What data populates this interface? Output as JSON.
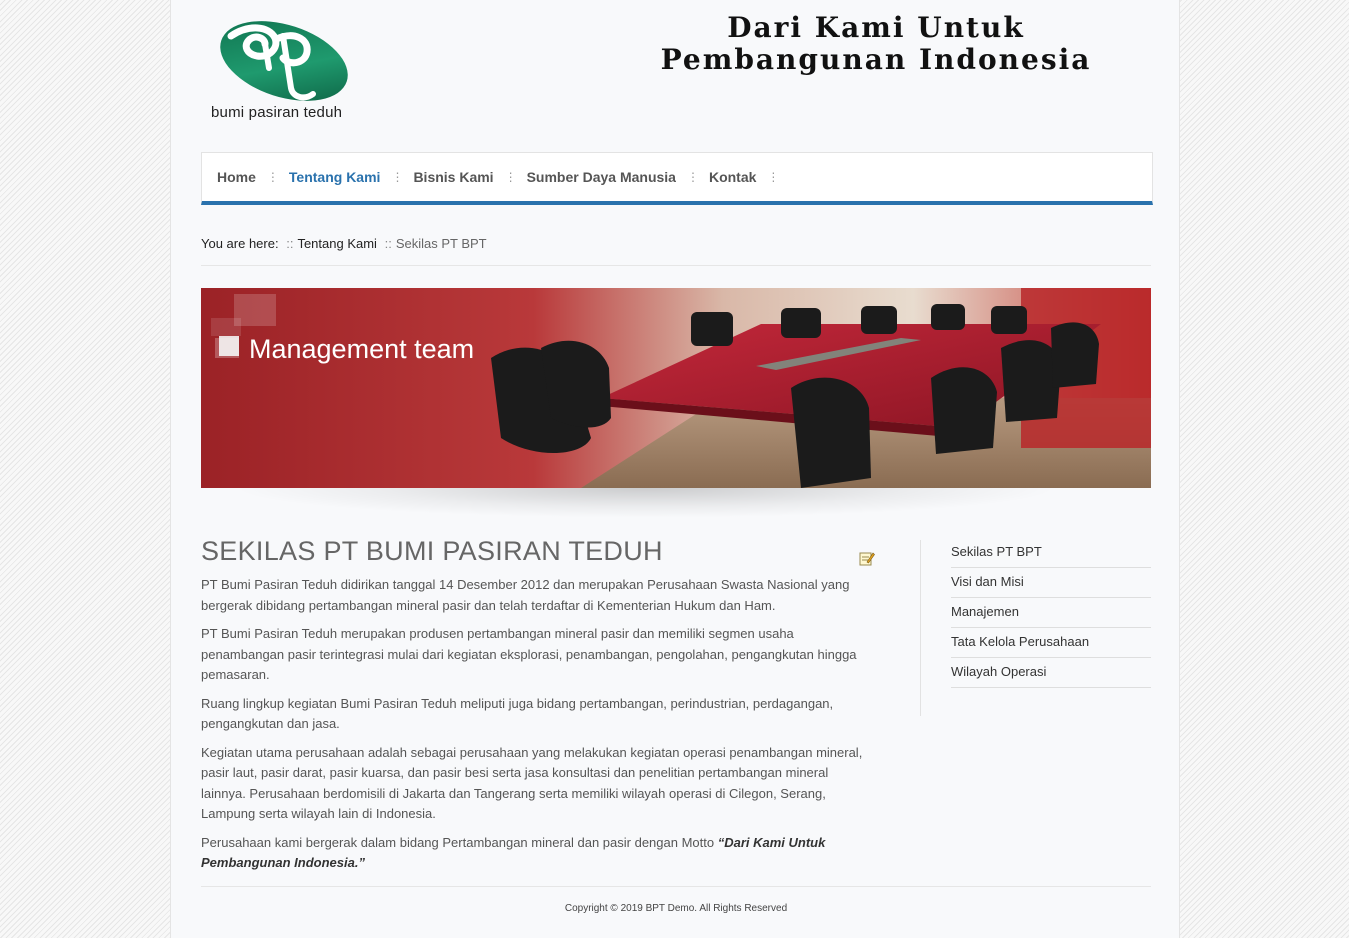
{
  "header": {
    "logo_text": "bumi pasiran teduh",
    "motto_line1": "Dari Kami Untuk",
    "motto_line2": "Pembangunan Indonesia"
  },
  "nav": {
    "items": [
      {
        "label": "Home",
        "active": false
      },
      {
        "label": "Tentang Kami",
        "active": true
      },
      {
        "label": "Bisnis Kami",
        "active": false
      },
      {
        "label": "Sumber Daya Manusia",
        "active": false
      },
      {
        "label": "Kontak",
        "active": false
      }
    ],
    "separator": "⋮"
  },
  "breadcrumb": {
    "prefix": "You are here:",
    "sep": "::",
    "parent": "Tentang Kami",
    "current": "Sekilas PT BPT"
  },
  "banner": {
    "caption": "Management team"
  },
  "article": {
    "title": "SEKILAS PT BUMI PASIRAN TEDUH",
    "paragraphs": [
      "PT Bumi Pasiran Teduh didirikan tanggal 14 Desember 2012 dan merupakan Perusahaan Swasta Nasional yang bergerak dibidang pertambangan mineral pasir dan telah terdaftar di Kementerian Hukum dan Ham.",
      "PT Bumi Pasiran Teduh merupakan produsen pertambangan mineral pasir dan memiliki segmen usaha penambangan pasir terintegrasi mulai dari kegiatan eksplorasi, penambangan, pengolahan, pengangkutan hingga pemasaran.",
      "Ruang lingkup kegiatan Bumi Pasiran Teduh meliputi juga bidang pertambangan, perindustrian, perdagangan, pengangkutan dan jasa.",
      "Kegiatan utama perusahaan adalah sebagai perusahaan yang melakukan kegiatan operasi penambangan mineral, pasir laut, pasir darat, pasir kuarsa, dan pasir besi serta jasa konsultasi dan penelitian pertambangan mineral lainnya. Perusahaan berdomisili di Jakarta dan Tangerang serta memiliki wilayah operasi di Cilegon, Serang, Lampung serta wilayah lain di Indonesia."
    ],
    "last_paragraph_text": "Perusahaan kami bergerak dalam bidang Pertambangan mineral dan pasir dengan Motto ",
    "last_paragraph_motto": "“Dari Kami Untuk Pembangunan Indonesia.”"
  },
  "sidebar": {
    "items": [
      "Sekilas PT BPT",
      "Visi dan Misi",
      "Manajemen",
      "Tata Kelola Perusahaan",
      "Wilayah Operasi"
    ]
  },
  "footer": {
    "copyright": "Copyright © 2019 BPT Demo. All Rights Reserved"
  },
  "colors": {
    "accent": "#2a72ad",
    "logo_green": "#1a8a62",
    "banner_red": "#a8252a"
  }
}
